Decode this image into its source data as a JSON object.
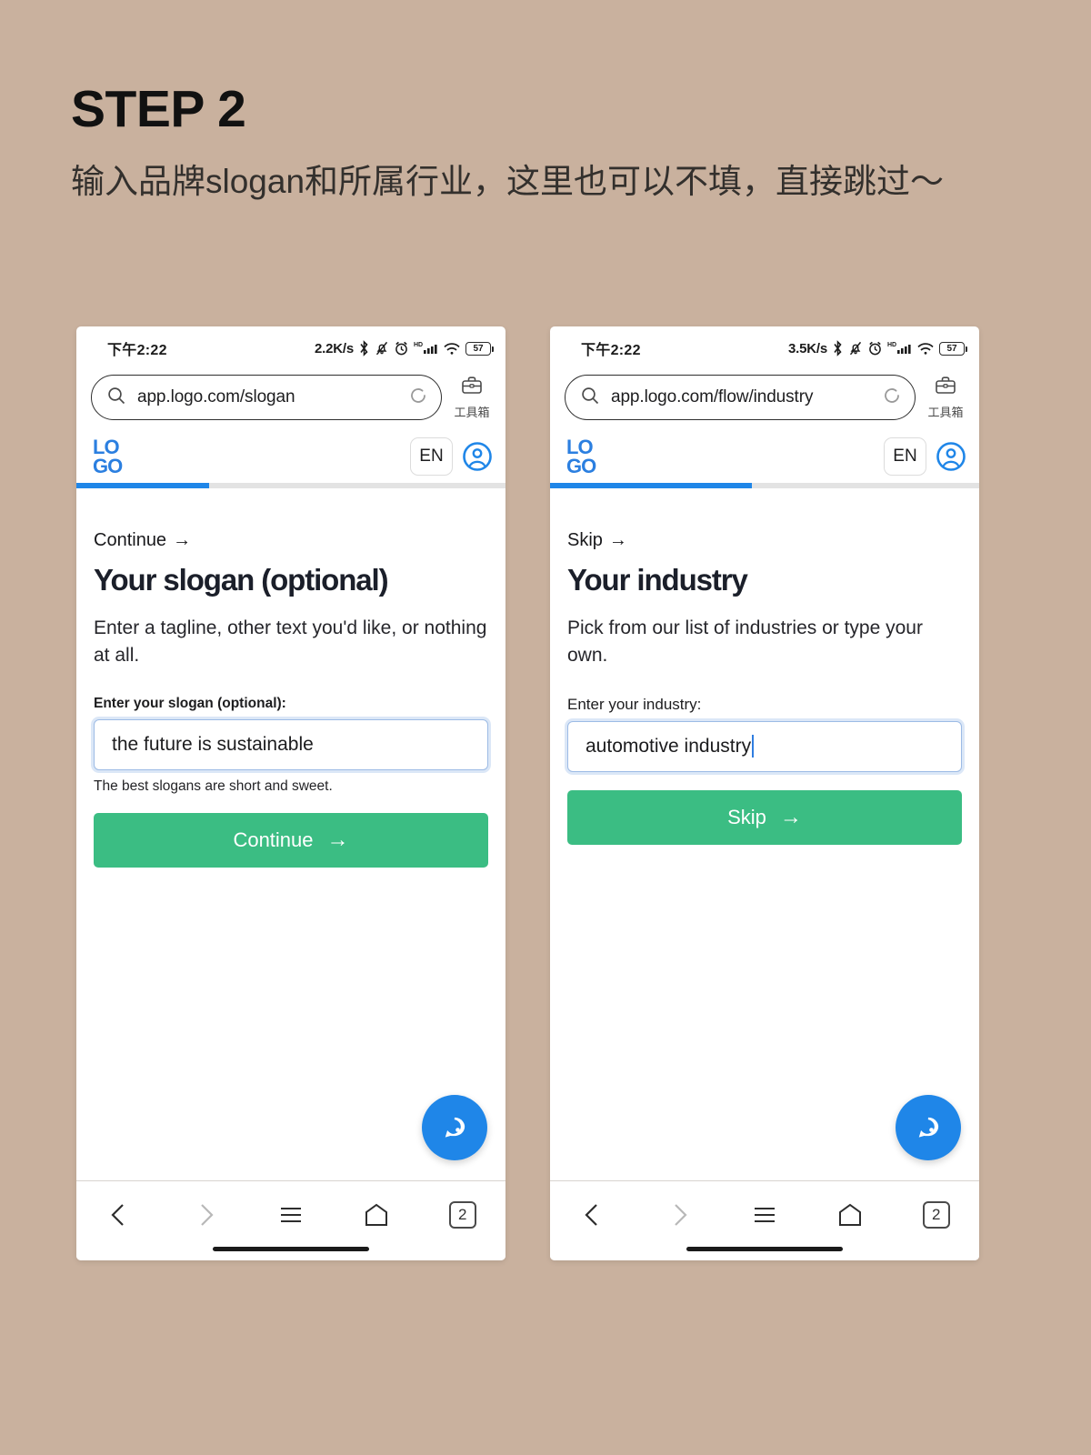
{
  "headline": {
    "step": "STEP 2",
    "description": "输入品牌slogan和所属行业，这里也可以不填，直接跳过～"
  },
  "theme": {
    "background": "#c9b19e",
    "brand_blue": "#1f86e8",
    "logo_blue": "#2b7fe0",
    "cta_green": "#3bbd83",
    "focus_ring": "#dbe7f7",
    "input_border": "#9dbbe5"
  },
  "phones": [
    {
      "id": "slogan-screen",
      "statusbar": {
        "time": "下午2:22",
        "network_speed": "2.2K/s",
        "bluetooth_icon": "bluetooth-icon",
        "mute_icon": "bell-muted-icon",
        "alarm_icon": "alarm-clock-icon",
        "hd_label": "HD",
        "signal_icon": "cellular-signal-icon",
        "wifi_icon": "wifi-icon",
        "battery_level": "57"
      },
      "browser": {
        "url": "app.logo.com/slogan",
        "search_icon": "search-icon",
        "reload_icon": "reload-icon",
        "toolbox_icon": "briefcase-icon",
        "toolbox_label": "工具箱"
      },
      "site_header": {
        "logo_top": "LO",
        "logo_bottom": "GO",
        "lang_button": "EN",
        "account_icon": "user-avatar-icon",
        "progress_percent": 31
      },
      "content": {
        "nav_link": "Continue",
        "nav_link_arrow": "→",
        "title": "Your slogan (optional)",
        "subtitle": "Enter a tagline, other text you'd like, or nothing at all.",
        "field_label": "Enter your slogan (optional):",
        "field_label_bold": true,
        "field_value": "the future is sustainable",
        "field_caret": false,
        "field_hint": "The best slogans are short and sweet.",
        "cta_label": "Continue",
        "cta_arrow": "→",
        "chat_icon": "chat-bubble-icon"
      },
      "bottom_nav": {
        "back_icon": "chevron-left-icon",
        "forward_icon": "chevron-right-icon",
        "menu_icon": "hamburger-menu-icon",
        "home_icon": "home-icon",
        "tabs_count": "2"
      }
    },
    {
      "id": "industry-screen",
      "statusbar": {
        "time": "下午2:22",
        "network_speed": "3.5K/s",
        "bluetooth_icon": "bluetooth-icon",
        "mute_icon": "bell-muted-icon",
        "alarm_icon": "alarm-clock-icon",
        "hd_label": "HD",
        "signal_icon": "cellular-signal-icon",
        "wifi_icon": "wifi-icon",
        "battery_level": "57"
      },
      "browser": {
        "url": "app.logo.com/flow/industry",
        "search_icon": "search-icon",
        "reload_icon": "reload-icon",
        "toolbox_icon": "briefcase-icon",
        "toolbox_label": "工具箱"
      },
      "site_header": {
        "logo_top": "LO",
        "logo_bottom": "GO",
        "lang_button": "EN",
        "account_icon": "user-avatar-icon",
        "progress_percent": 47
      },
      "content": {
        "nav_link": "Skip",
        "nav_link_arrow": "→",
        "title": "Your industry",
        "subtitle": "Pick from our list of industries or type your own.",
        "field_label": "Enter your industry:",
        "field_label_bold": false,
        "field_value": "automotive industry",
        "field_caret": true,
        "field_hint": "",
        "cta_label": "Skip",
        "cta_arrow": "→",
        "chat_icon": "chat-bubble-icon"
      },
      "bottom_nav": {
        "back_icon": "chevron-left-icon",
        "forward_icon": "chevron-right-icon",
        "menu_icon": "hamburger-menu-icon",
        "home_icon": "home-icon",
        "tabs_count": "2"
      }
    }
  ]
}
